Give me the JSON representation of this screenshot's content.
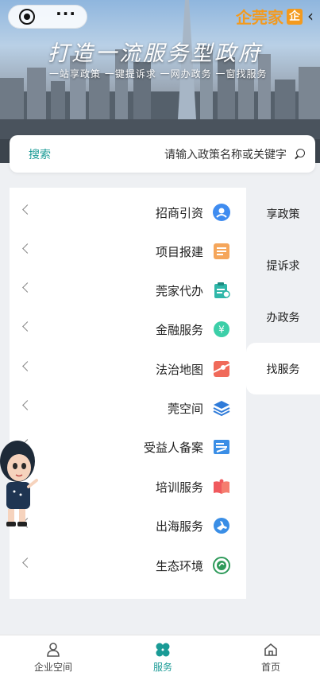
{
  "header": {
    "brand_name": "企莞家",
    "brand_logo_letter": "企",
    "back_icon": "chevron-left-icon",
    "slogan": "打造一流服务型政府",
    "subline": "一站享政策 一键提诉求 一网办政务 一窗找服务"
  },
  "search": {
    "placeholder": "请输入政策名称或关键字",
    "button_label": "搜索"
  },
  "side_tabs": [
    {
      "label": "享政策",
      "active": false
    },
    {
      "label": "提诉求",
      "active": false
    },
    {
      "label": "办政务",
      "active": false
    },
    {
      "label": "找服务",
      "active": true
    }
  ],
  "services": [
    {
      "label": "招商引资",
      "icon": "location-person-icon",
      "color": "#3f8cf0"
    },
    {
      "label": "项目报建",
      "icon": "document-list-icon",
      "color": "#f5a65b"
    },
    {
      "label": "莞家代办",
      "icon": "clipboard-icon",
      "color": "#2fb7a9"
    },
    {
      "label": "金融服务",
      "icon": "yuan-coin-icon",
      "color": "#3ccfa8"
    },
    {
      "label": "法治地图",
      "icon": "map-pin-icon",
      "color": "#f06a5a"
    },
    {
      "label": "莞空间",
      "icon": "layers-icon",
      "color": "#2f7bd9"
    },
    {
      "label": "受益人备案",
      "icon": "form-edit-icon",
      "color": "#3a8ee6"
    },
    {
      "label": "培训服务",
      "icon": "open-book-icon",
      "color": "#f0595d"
    },
    {
      "label": "出海服务",
      "icon": "airplane-globe-icon",
      "color": "#3a8ee6"
    },
    {
      "label": "生态环境",
      "icon": "eco-badge-icon",
      "color": "#2e9a5a"
    }
  ],
  "tabbar": {
    "items": [
      {
        "label": "首页",
        "icon": "home-icon",
        "active": false
      },
      {
        "label": "服务",
        "icon": "grid-clover-icon",
        "active": true
      },
      {
        "label": "企业空间",
        "icon": "user-icon",
        "active": false
      }
    ]
  },
  "colors": {
    "accent": "#1a9b96",
    "brand": "#f39a1e"
  }
}
